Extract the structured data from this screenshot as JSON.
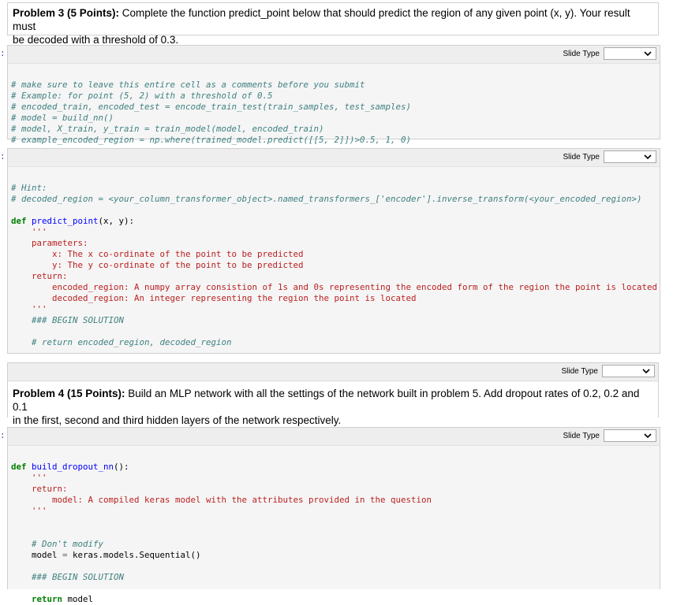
{
  "cells": {
    "p3": {
      "heading": "Problem 3 (5 Points):",
      "text1": " Complete the function predict_point below that should predict the region of any given point (x, y). Your result must",
      "text2": "be decoded with a threshold of 0.3."
    },
    "toolbar_label": "Slide Type",
    "prompt_glyph": ":",
    "c1": [
      "# make sure to leave this entire cell as a comments before you submit",
      "# Example: for point (5, 2) with a threshold of 0.5",
      "# encoded_train, encoded_test = encode_train_test(train_samples, test_samples)",
      "# model = build_nn()",
      "# model, X_train, y_train = train_model(model, encoded_train)",
      "# example_encoded_region = np.where(trained_model.predict([[5, 2]])>0.5, 1, 0)"
    ],
    "c2": {
      "hint1": "# Hint:",
      "hint2": "# decoded_region = <your_column_transformer_object>.named_transformers_['encoder'].inverse_transform(<your_encoded_region>)",
      "def_kw": "def",
      "fn_name": "predict_point",
      "fn_args": "(x, y):",
      "q1": "    '''",
      "doc": [
        "    parameters:",
        "        x: The x co-ordinate of the point to be predicted",
        "        y: The y co-ordinate of the point to be predicted",
        "    return:",
        "        encoded_region: A numpy array consistion of 1s and 0s representing the encoded form of the region the point is located",
        "        decoded_region: An integer representing the region the point is located"
      ],
      "q2": "    '''",
      "begin": "    ### BEGIN SOLUTION",
      "ret": "    # return encoded_region, decoded_region"
    },
    "p4": {
      "heading": "Problem 4 (15 Points):",
      "text1": " Build an MLP network with all the settings of the network built in problem 5. Add dropout rates of 0.2, 0.2 and 0.1",
      "text2": "in the first, second and third hidden layers of the network respectively."
    },
    "c3": {
      "def_kw": "def",
      "fn_name": "build_dropout_nn",
      "fn_args": "():",
      "q1": "    '''",
      "doc": [
        "    return:",
        "        model: A compiled keras model with the attributes provided in the question"
      ],
      "q2": "    '''",
      "dont": "    # Don't modify",
      "model_lhs": "    model ",
      "eq": "=",
      "model_rhs": " keras.models.Sequential()",
      "begin": "    ### BEGIN SOLUTION",
      "ret_kw": "    return",
      "ret_val": " model"
    }
  }
}
